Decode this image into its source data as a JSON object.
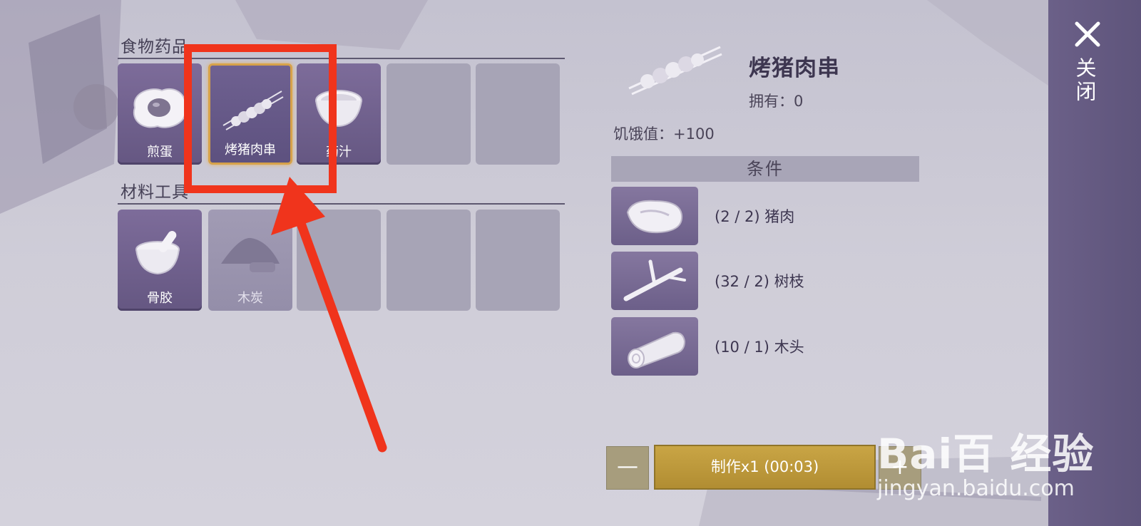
{
  "sections": {
    "food": {
      "title": "食物药品"
    },
    "materials": {
      "title": "材料工具"
    }
  },
  "food_items": [
    {
      "label": "煎蛋",
      "icon": "fried-egg-icon"
    },
    {
      "label": "烤猪肉串",
      "icon": "pork-skewer-icon",
      "selected": true
    },
    {
      "label": "药汁",
      "icon": "potion-bowl-icon"
    }
  ],
  "material_items": [
    {
      "label": "骨胶",
      "icon": "mortar-bowl-icon"
    },
    {
      "label": "木炭",
      "icon": "charcoal-pile-icon",
      "dimmed": true
    }
  ],
  "detail": {
    "title": "烤猪肉串",
    "owned": "拥有：0",
    "hunger": "饥饿值：+100",
    "conditions_header": "条件",
    "materials": [
      {
        "text": "(2 / 2) 猪肉",
        "icon": "pork-meat-icon"
      },
      {
        "text": "(32 / 2) 树枝",
        "icon": "branch-icon"
      },
      {
        "text": "(10 / 1) 木头",
        "icon": "log-icon"
      }
    ]
  },
  "controls": {
    "minus": "—",
    "craft": "制作x1 (00:03)",
    "plus": "+"
  },
  "close_label": "关闭",
  "watermark": {
    "main": "Bai百 经验",
    "sub": "jingyan.baidu.com"
  },
  "colors": {
    "highlight_box": "#f0341c",
    "accent_gold": "#c9a545",
    "panel": "#6b6088"
  }
}
